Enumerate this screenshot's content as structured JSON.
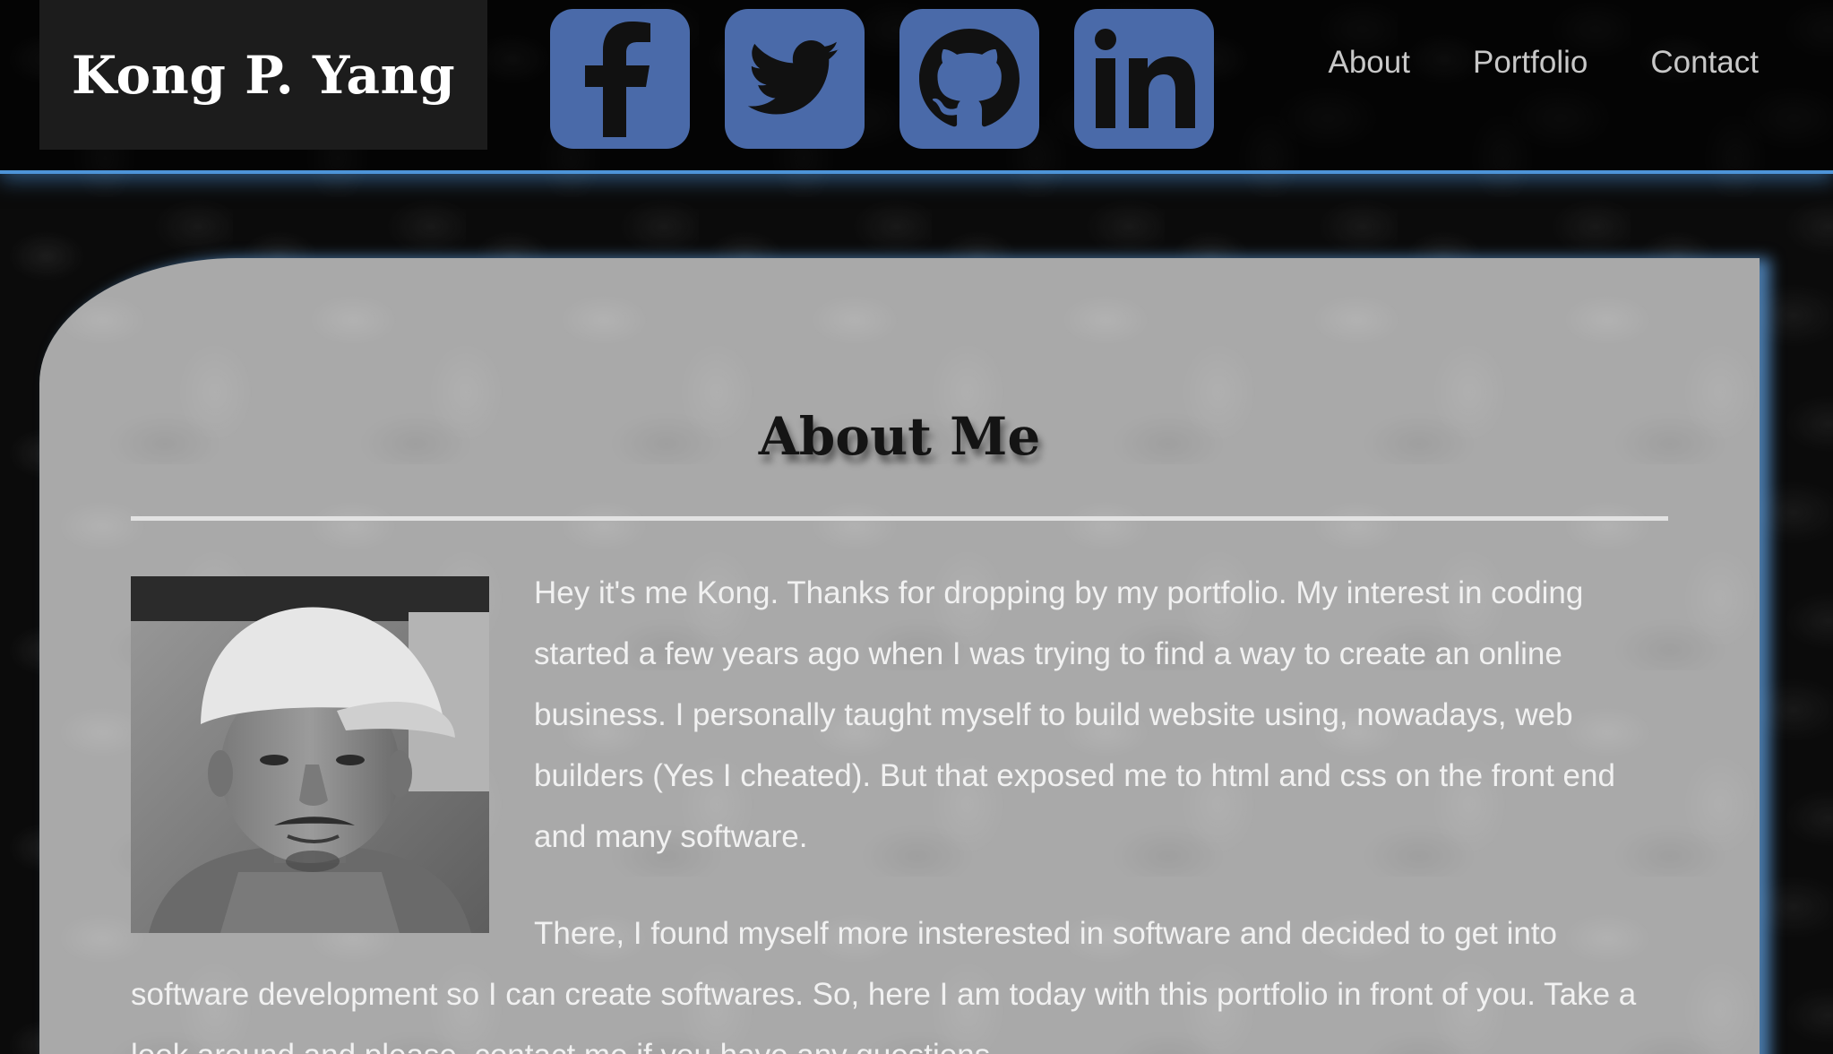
{
  "brand": {
    "name": "Kong P. Yang"
  },
  "social": [
    {
      "icon": "facebook-icon"
    },
    {
      "icon": "twitter-icon"
    },
    {
      "icon": "github-icon"
    },
    {
      "icon": "linkedin-icon"
    }
  ],
  "nav": {
    "about": "About",
    "portfolio": "Portfolio",
    "contact": "Contact"
  },
  "about": {
    "title": "About Me",
    "photo_icon": "profile-photo",
    "paragraph1": "Hey it's me Kong. Thanks for dropping by my portfolio. My interest in coding started a few years ago when I was trying to find a way to create an online business. I personally taught myself to build website using, nowadays, web builders (Yes I cheated). But that exposed me to html and css on the front end and many software.",
    "paragraph2": "There, I found myself more insterested in software and decided to get into software development so I can create softwares. So, here I am today with this portfolio in front of you. Take a look around and please, contact me if you have any questions."
  },
  "colors": {
    "accent": "#4d94d8",
    "social_bg": "#4a6aa9",
    "card_bg": "#a9a9a9",
    "brand_bg": "#1c1c1c"
  }
}
